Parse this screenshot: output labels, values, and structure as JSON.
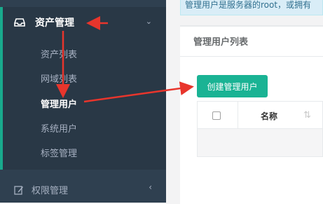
{
  "sidebar": {
    "asset_menu": {
      "label": "资产管理",
      "icon": "inbox-icon",
      "items": [
        {
          "label": "资产列表"
        },
        {
          "label": "网域列表"
        },
        {
          "label": "管理用户"
        },
        {
          "label": "系统用户"
        },
        {
          "label": "标签管理"
        }
      ]
    },
    "permission_menu": {
      "label": "权限管理",
      "icon": "edit-icon"
    }
  },
  "info_bar": {
    "text": "管理用户是服务器的root，或拥有"
  },
  "panel": {
    "title": "管理用户列表",
    "create_button": "创建管理用户",
    "table": {
      "columns": [
        "",
        "名称"
      ]
    }
  },
  "colors": {
    "sidebar_bg": "#2f4050",
    "accent": "#1ab394",
    "annotation_arrow": "#e8352c"
  }
}
